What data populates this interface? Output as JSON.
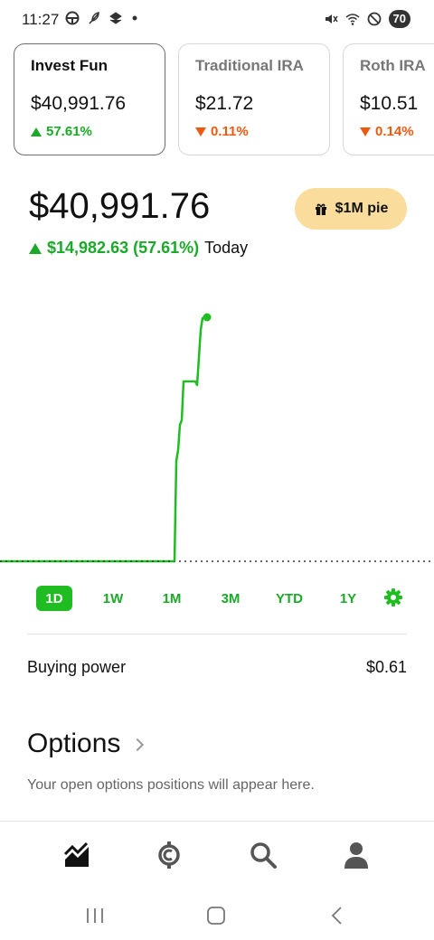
{
  "status_bar": {
    "time": "11:27",
    "battery": "70"
  },
  "accounts": [
    {
      "name": "Invest Fun",
      "value": "$40,991.76",
      "change": "57.61%",
      "direction": "up",
      "selected": true
    },
    {
      "name": "Traditional IRA",
      "value": "$21.72",
      "change": "0.11%",
      "direction": "down",
      "selected": false
    },
    {
      "name": "Roth IRA",
      "value": "$10.51",
      "change": "0.14%",
      "direction": "down",
      "selected": false
    }
  ],
  "portfolio": {
    "value": "$40,991.76",
    "change": "$14,982.63 (57.61%)",
    "change_label": "Today",
    "promo_button": "$1M pie"
  },
  "chart_data": {
    "type": "line",
    "period": "1D",
    "color": "#1fbd22",
    "baseline": "flat-until-midday"
  },
  "range_tabs": [
    "1D",
    "1W",
    "1M",
    "3M",
    "YTD",
    "1Y"
  ],
  "active_tab": "1D",
  "buying_power": {
    "label": "Buying power",
    "value": "$0.61"
  },
  "options": {
    "title": "Options",
    "subtitle": "Your open options positions will appear here."
  },
  "bottom_nav": [
    "investing-icon",
    "crypto-icon",
    "search-icon",
    "account-icon"
  ],
  "colors": {
    "accent_green": "#1fbd22",
    "down_orange": "#ec5a12",
    "promo_bg": "#fadd9d"
  }
}
